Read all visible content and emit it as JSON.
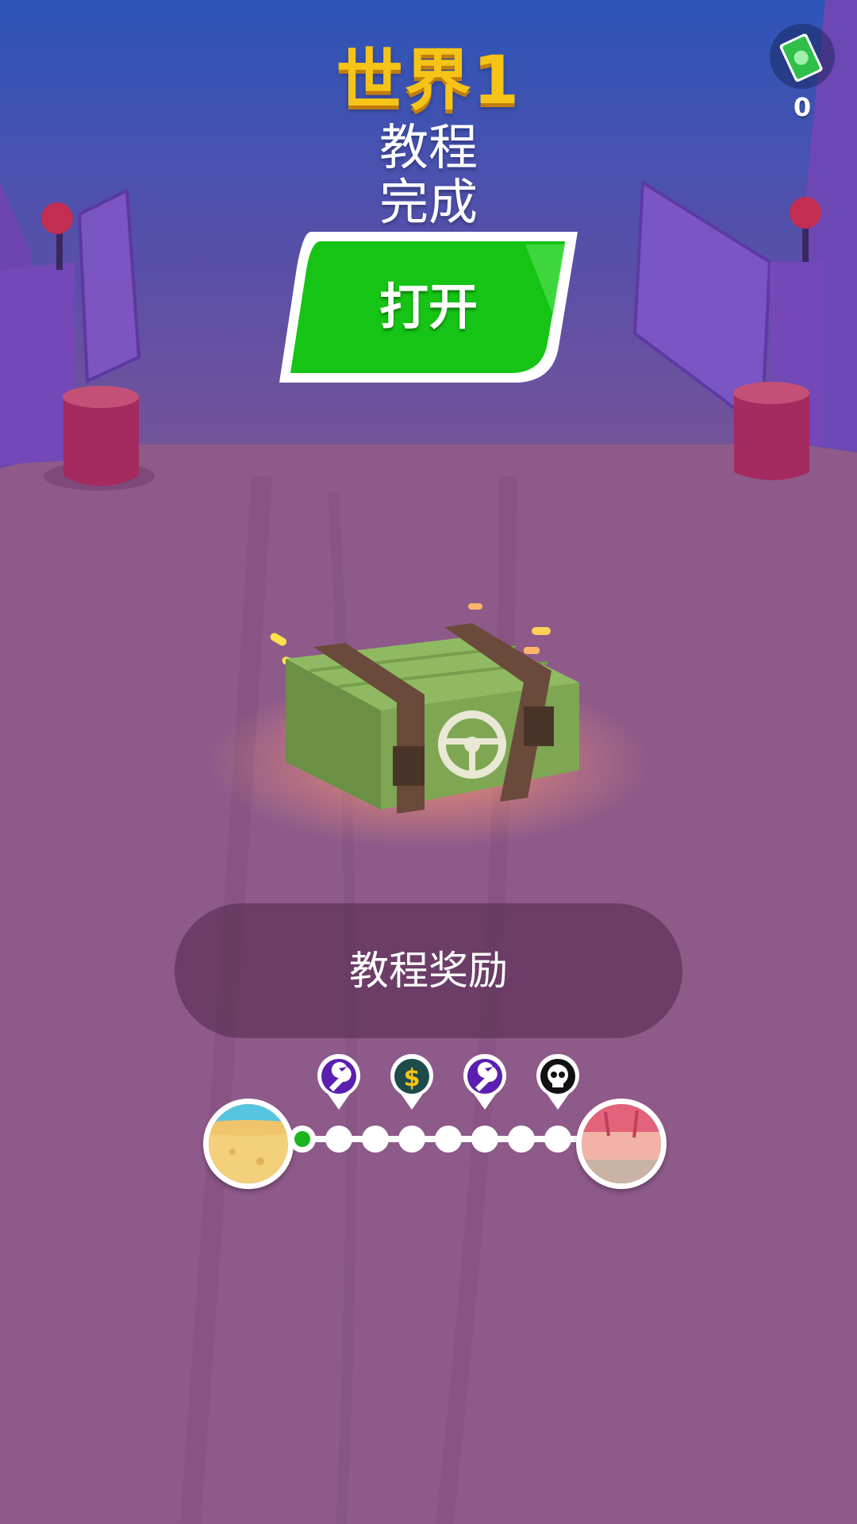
{
  "header": {
    "world_title": "世界1",
    "subtitle_line1": "教程",
    "subtitle_line2": "完成"
  },
  "open_button": {
    "label": "打开",
    "color": "#15c415"
  },
  "currency": {
    "amount": "0",
    "icon": "cash-icon"
  },
  "reward": {
    "label": "教程奖励",
    "icon": "steering-wheel-icon"
  },
  "progress": {
    "current_stage": 1,
    "total_stages": 8,
    "markers": [
      {
        "icon": "wrench-icon",
        "color": "#5a1fb0"
      },
      {
        "icon": "dollar-icon",
        "color": "#1e4a4a"
      },
      {
        "icon": "wrench-icon",
        "color": "#5a1fb0"
      },
      {
        "icon": "skull-icon",
        "color": "#111111"
      }
    ],
    "start_world": "desert-world-icon",
    "end_world": "pink-world-icon"
  },
  "colors": {
    "title_yellow": "#f6c417",
    "sky": "#2f55b5",
    "ground": "#8e5a8a",
    "crate": "#7da355"
  }
}
